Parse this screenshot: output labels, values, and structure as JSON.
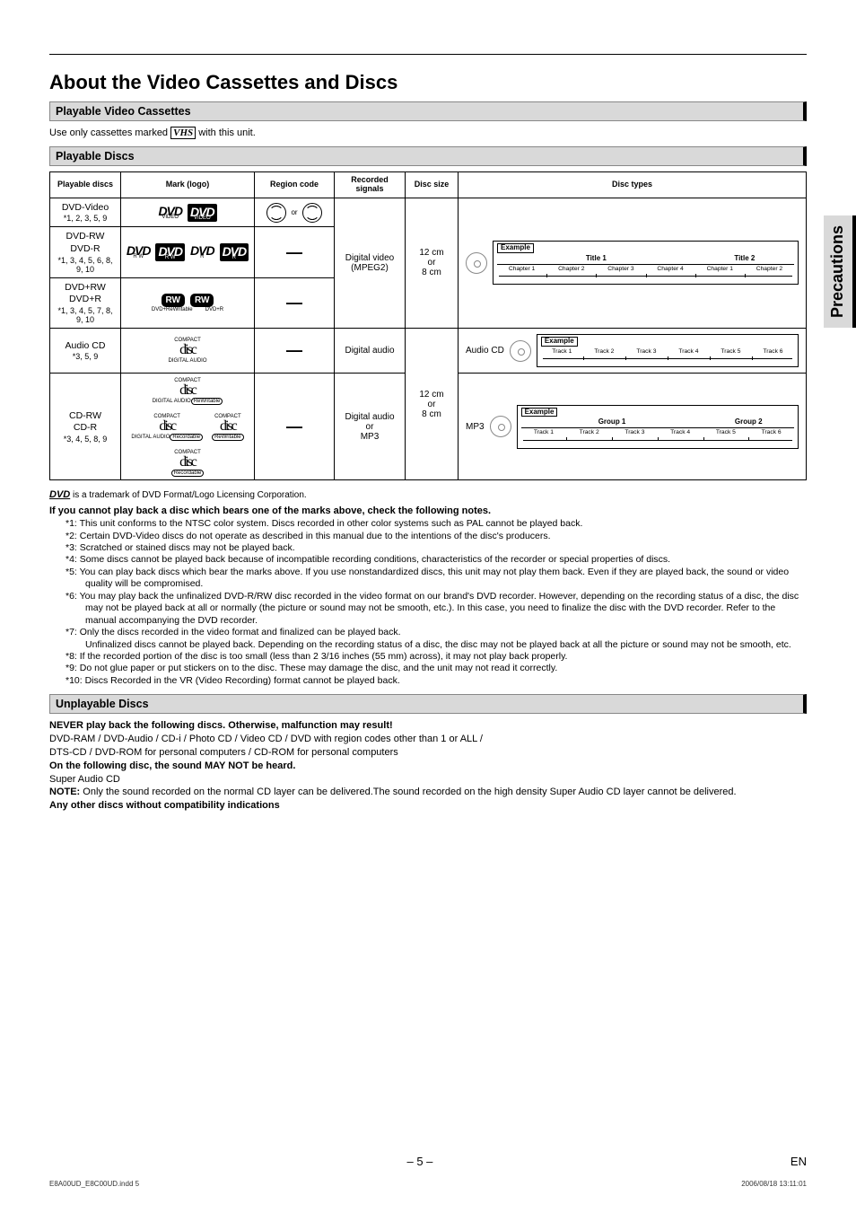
{
  "side_tab": "Precautions",
  "title": "About the Video Cassettes and Discs",
  "sections": {
    "cassettes_bar": "Playable Video Cassettes",
    "cassettes_text_a": "Use only cassettes marked ",
    "cassettes_text_b": "VHS",
    "cassettes_text_c": " with this unit.",
    "playable_bar": "Playable Discs",
    "unplayable_bar": "Unplayable Discs"
  },
  "table": {
    "headers": {
      "discs": "Playable discs",
      "mark": "Mark (logo)",
      "region": "Region code",
      "recorded": "Recorded signals",
      "size": "Disc size",
      "types": "Disc types"
    },
    "rows": [
      {
        "name": "DVD-Video",
        "sub": "*1, 2, 3, 5, 9",
        "region_or": "or",
        "recorded": "",
        "size": "",
        "types": ""
      },
      {
        "name": "DVD-RW\nDVD-R",
        "sub": "*1, 3, 4, 5, 6, 8, 9, 10",
        "recorded": "Digital video (MPEG2)",
        "size": "12 cm\nor\n8 cm"
      },
      {
        "name": "DVD+RW\nDVD+R",
        "sub": "*1, 3, 4, 5, 7, 8, 9, 10"
      },
      {
        "name": "Audio CD",
        "sub": "*3, 5, 9",
        "recorded": "Digital audio"
      },
      {
        "name": "CD-RW\nCD-R",
        "sub": "*3, 4, 5, 8, 9",
        "recorded": "Digital audio\nor\nMP3",
        "size2": "12 cm\nor\n8 cm"
      }
    ],
    "diagrams": {
      "dvd": {
        "example": "Example",
        "titles": [
          "Title 1",
          "Title 2"
        ],
        "chapters1": [
          "Chapter 1",
          "Chapter 2",
          "Chapter 3",
          "Chapter 4"
        ],
        "chapters2": [
          "Chapter 1",
          "Chapter 2"
        ]
      },
      "cd": {
        "label": "Audio CD",
        "example": "Example",
        "tracks": [
          "Track 1",
          "Track 2",
          "Track 3",
          "Track 4",
          "Track 5",
          "Track 6"
        ]
      },
      "mp3": {
        "label": "MP3",
        "example": "Example",
        "groups": [
          "Group 1",
          "Group 2"
        ],
        "tracks1": [
          "Track 1",
          "Track 2",
          "Track 3",
          "Track 4"
        ],
        "tracks2": [
          "Track 5",
          "Track 6"
        ]
      }
    }
  },
  "trademark": " is a trademark of DVD Format/Logo Licensing Corporation.",
  "notes_title": "If you cannot play back a disc which bears one of the marks above, check the following notes.",
  "notes": [
    "*1: This unit conforms to the NTSC color system. Discs recorded in other color systems such as PAL cannot be played back.",
    "*2: Certain DVD-Video discs do not operate as described in this manual due to the intentions of the disc's producers.",
    "*3: Scratched or stained discs may not be played back.",
    "*4: Some discs cannot be played back because of incompatible recording conditions, characteristics of the recorder or special properties of discs.",
    "*5: You can play back discs which bear the marks above. If you use nonstandardized discs, this unit may not play them back. Even if they are played back, the sound or video quality will be compromised.",
    "*6: You may play back the unfinalized DVD-R/RW disc recorded in the video format on our brand's DVD recorder. However, depending on the recording status of a disc, the disc may not be played back at all or normally (the picture or sound may not be smooth, etc.). In this case, you need to finalize the disc with the DVD recorder. Refer to the manual accompanying the DVD recorder.",
    "*7: Only the discs recorded in the video format and finalized can be played back.\nUnfinalized discs cannot be played back. Depending on the recording status of a disc, the disc may not be played back at all the picture or sound may not be smooth, etc.",
    "*8: If the recorded portion of the disc is too small (less than 2 3/16 inches (55 mm) across), it may not play back properly.",
    "*9: Do not glue paper or put stickers on to the disc. These may damage the disc, and the unit may not read it correctly.",
    "*10: Discs Recorded in the VR (Video Recording) format cannot be played back."
  ],
  "unplayable": {
    "warn": "NEVER play back the following discs. Otherwise, malfunction may result!",
    "line1": "DVD-RAM / DVD-Audio / CD-i / Photo CD / Video CD / DVD with region codes other than 1 or ALL /",
    "line2": "DTS-CD / DVD-ROM for personal computers / CD-ROM for personal computers",
    "sound_warn": "On the following disc, the sound MAY NOT be heard.",
    "sacd": "Super Audio CD",
    "note_label": "NOTE:",
    "note_body": " Only the sound recorded on the normal CD layer can be delivered.The sound recorded on the high density Super Audio CD layer cannot be delivered.",
    "other": "Any other discs without compatibility indications"
  },
  "footer": {
    "page": "– 5 –",
    "en": "EN",
    "indd": "E8A00UD_E8C00UD.indd   5",
    "timestamp": "2006/08/18   13:11:01"
  }
}
